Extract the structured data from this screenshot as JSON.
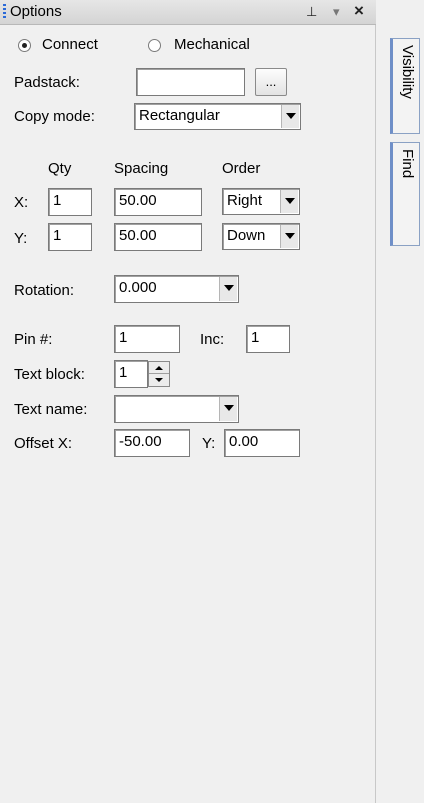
{
  "window": {
    "title": "Options",
    "pin_glyph": "⊥",
    "menu_glyph": "▾",
    "close_glyph": "×"
  },
  "side_tabs": [
    {
      "label": "Visibility"
    },
    {
      "label": "Find"
    }
  ],
  "mode": {
    "options": [
      "Connect",
      "Mechanical"
    ],
    "selected": "Connect"
  },
  "padstack": {
    "label": "Padstack:",
    "value": "",
    "browse_label": "..."
  },
  "copy_mode": {
    "label": "Copy mode:",
    "value": "Rectangular"
  },
  "grid": {
    "headers": {
      "qty": "Qty",
      "spacing": "Spacing",
      "order": "Order"
    },
    "x": {
      "label": "X:",
      "qty": "1",
      "spacing": "50.00",
      "order": "Right"
    },
    "y": {
      "label": "Y:",
      "qty": "1",
      "spacing": "50.00",
      "order": "Down"
    }
  },
  "rotation": {
    "label": "Rotation:",
    "value": "0.000"
  },
  "pin": {
    "label": "Pin #:",
    "value": "1",
    "inc_label": "Inc:",
    "inc_value": "1"
  },
  "text_block": {
    "label": "Text block:",
    "value": "1"
  },
  "text_name": {
    "label": "Text name:",
    "value": ""
  },
  "offset": {
    "label": "Offset X:",
    "x_value": "-50.00",
    "y_label": "Y:",
    "y_value": "0.00"
  }
}
